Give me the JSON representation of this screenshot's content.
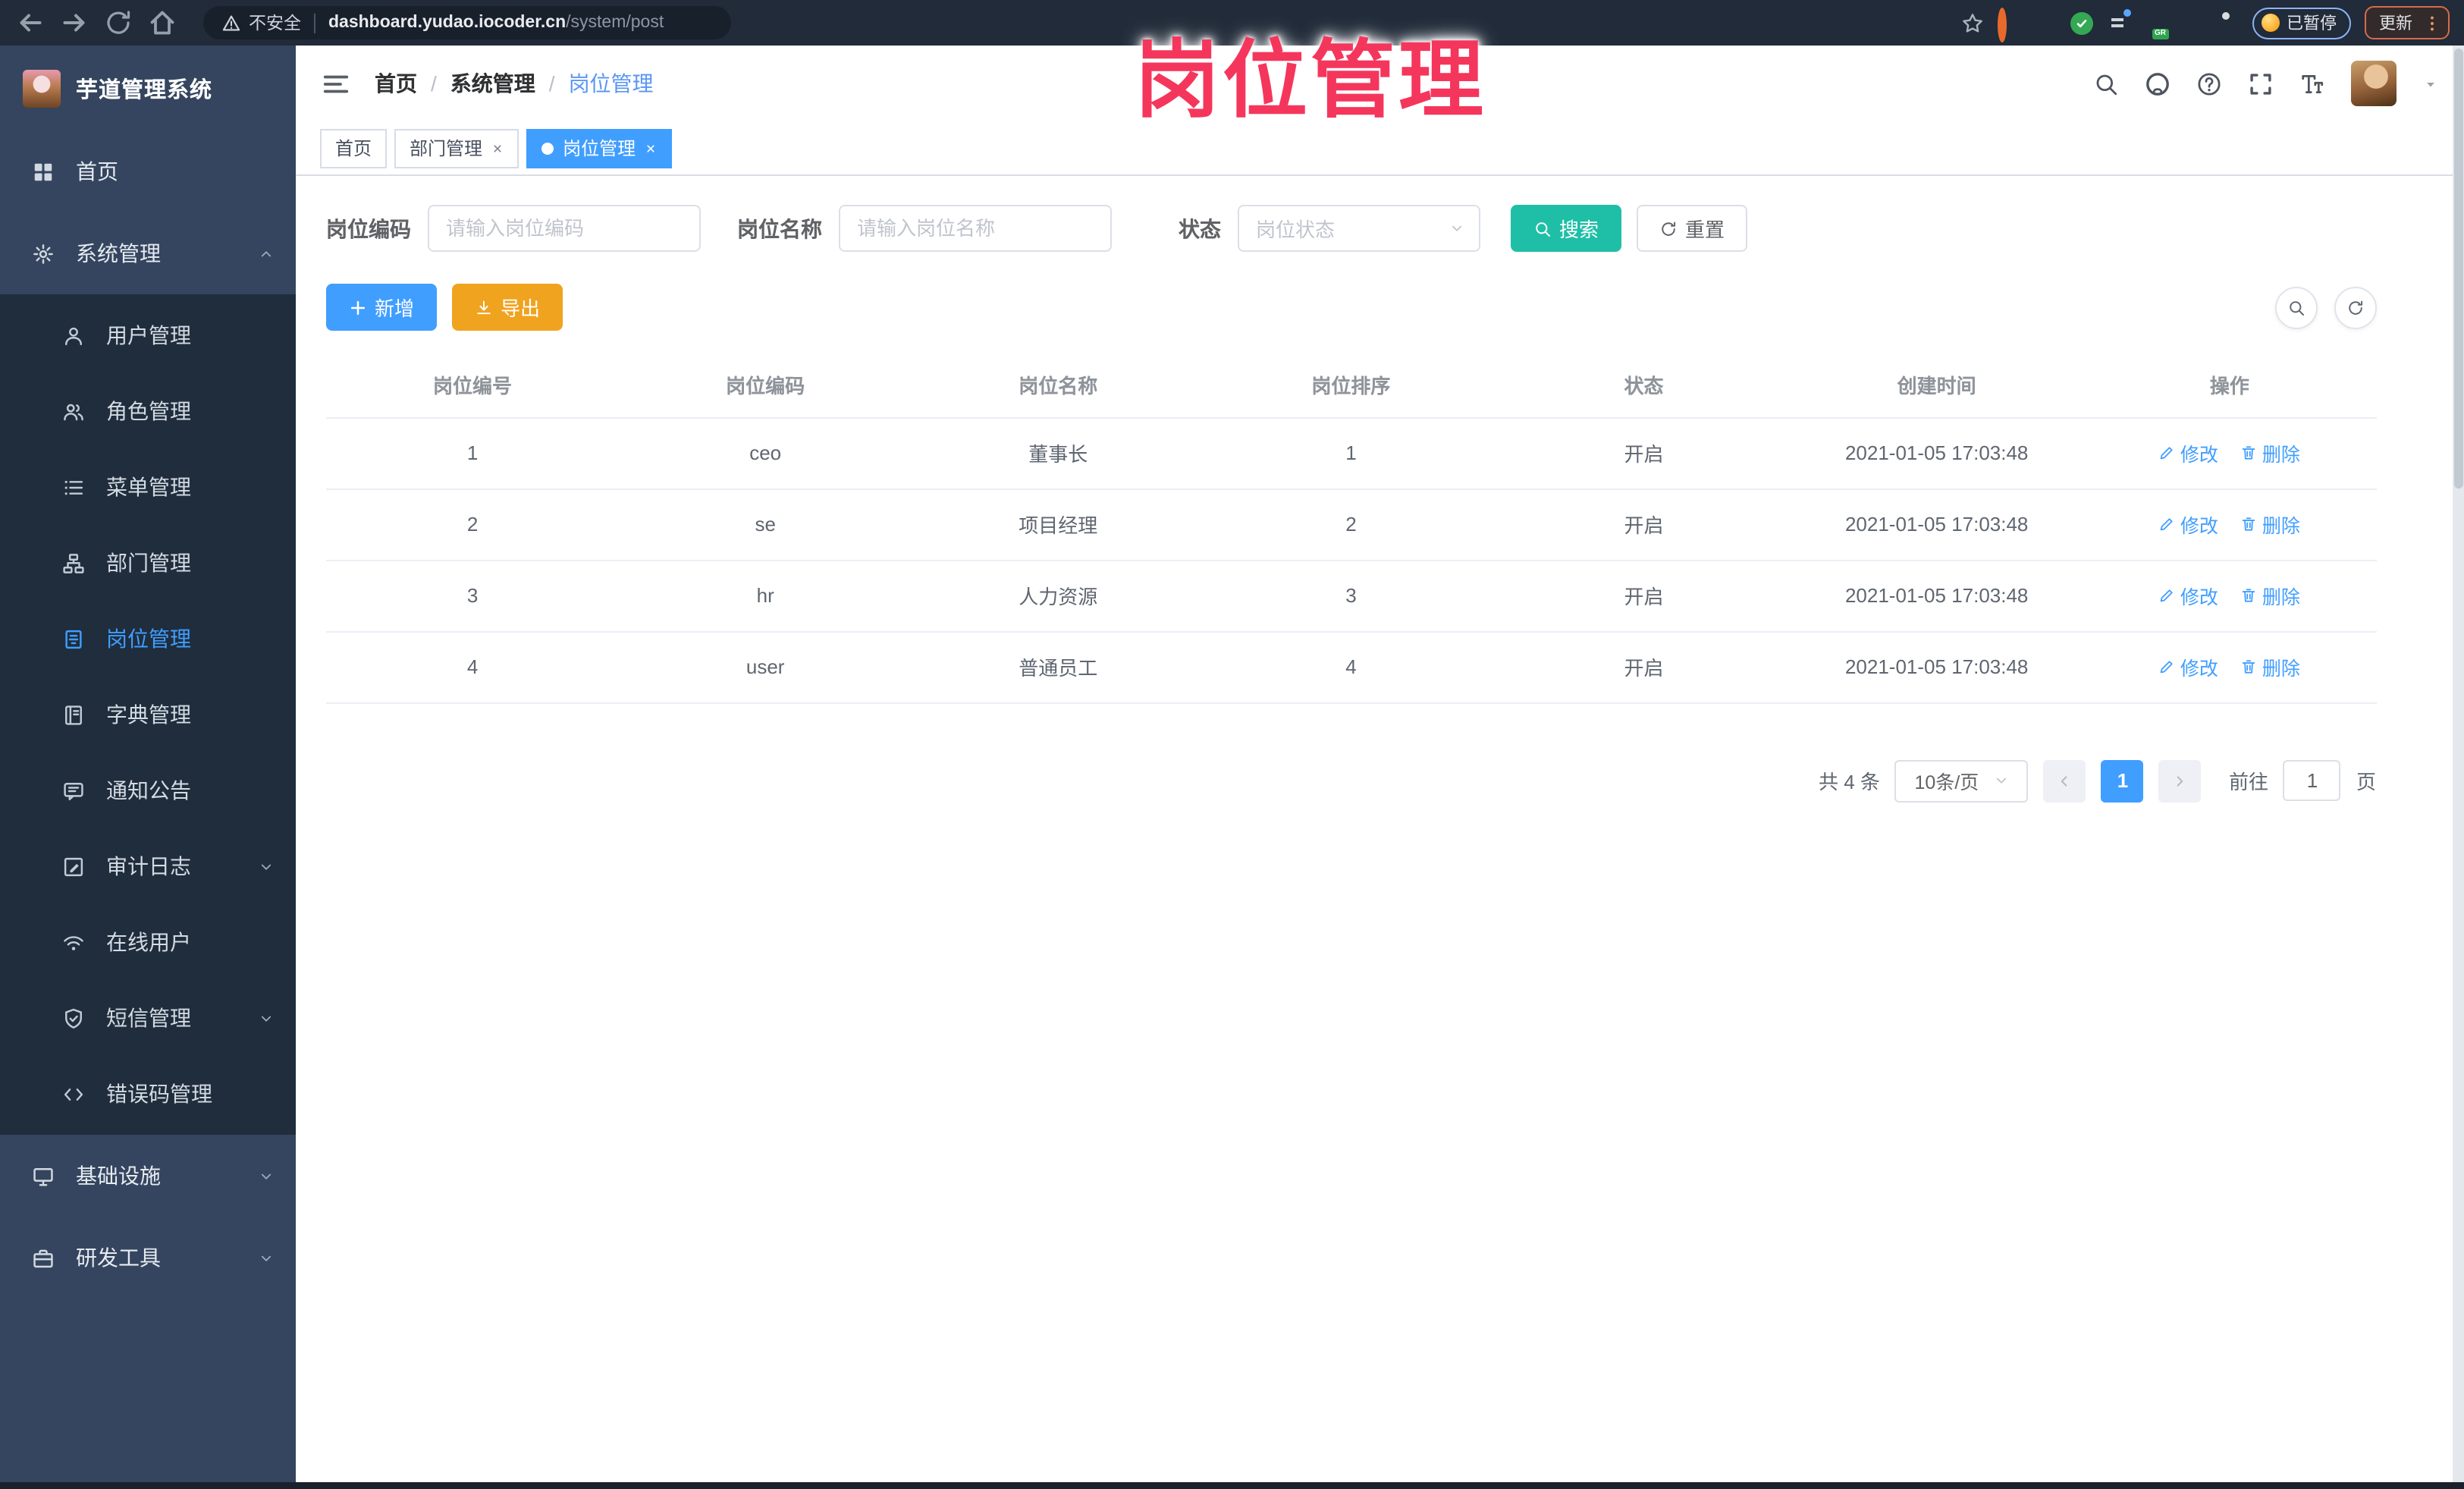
{
  "overlay_title": "岗位管理",
  "accent_colors": {
    "primary": "#409EFF",
    "success": "#1fbfa7",
    "warning": "#f0a31f",
    "annotation": "#f5365c"
  },
  "browser": {
    "security_label": "不安全",
    "url_host": "dashboard.yudao.iocoder.cn",
    "url_path": "/system/post",
    "paused_label": "已暂停",
    "update_label": "更新"
  },
  "sidebar": {
    "title": "芋道管理系统",
    "groups": [
      {
        "type": "item",
        "name": "home",
        "icon": "dashboard",
        "label": "首页"
      },
      {
        "type": "item",
        "name": "system-management",
        "icon": "gear",
        "label": "系统管理",
        "chevron": "up"
      },
      {
        "type": "submenu",
        "items": [
          {
            "name": "user-management",
            "icon": "user",
            "label": "用户管理"
          },
          {
            "name": "role-management",
            "icon": "users",
            "label": "角色管理"
          },
          {
            "name": "menu-management",
            "icon": "list",
            "label": "菜单管理"
          },
          {
            "name": "dept-management",
            "icon": "tree",
            "label": "部门管理"
          },
          {
            "name": "post-management",
            "icon": "post",
            "label": "岗位管理",
            "active": true
          },
          {
            "name": "dict-management",
            "icon": "book",
            "label": "字典管理"
          },
          {
            "name": "notice-announcement",
            "icon": "chat",
            "label": "通知公告"
          },
          {
            "name": "audit-log",
            "icon": "edit",
            "label": "审计日志",
            "chevron": "down"
          },
          {
            "name": "online-users",
            "icon": "wifi",
            "label": "在线用户"
          },
          {
            "name": "sms-management",
            "icon": "shield",
            "label": "短信管理",
            "chevron": "down"
          },
          {
            "name": "error-code-management",
            "icon": "code",
            "label": "错误码管理"
          }
        ]
      },
      {
        "type": "item",
        "name": "infrastructure",
        "icon": "infra",
        "label": "基础设施",
        "chevron": "down"
      },
      {
        "type": "item",
        "name": "dev-tools",
        "icon": "tools",
        "label": "研发工具",
        "chevron": "down"
      }
    ]
  },
  "header": {
    "breadcrumb": [
      "首页",
      "系统管理",
      "岗位管理"
    ]
  },
  "tabs": [
    {
      "name": "home",
      "label": "首页"
    },
    {
      "name": "dept-management",
      "label": "部门管理",
      "closable": true
    },
    {
      "name": "post-management",
      "label": "岗位管理",
      "closable": true,
      "active": true
    }
  ],
  "filters": {
    "code_label": "岗位编码",
    "code_placeholder": "请输入岗位编码",
    "name_label": "岗位名称",
    "name_placeholder": "请输入岗位名称",
    "status_label": "状态",
    "status_placeholder": "岗位状态",
    "search_label": "搜索",
    "reset_label": "重置"
  },
  "toolbar": {
    "add_label": "新增",
    "export_label": "导出"
  },
  "table": {
    "headers": [
      "岗位编号",
      "岗位编码",
      "岗位名称",
      "岗位排序",
      "状态",
      "创建时间",
      "操作"
    ],
    "rows": [
      {
        "id": "1",
        "code": "ceo",
        "name": "董事长",
        "sort": "1",
        "status": "开启",
        "created": "2021-01-05 17:03:48"
      },
      {
        "id": "2",
        "code": "se",
        "name": "项目经理",
        "sort": "2",
        "status": "开启",
        "created": "2021-01-05 17:03:48"
      },
      {
        "id": "3",
        "code": "hr",
        "name": "人力资源",
        "sort": "3",
        "status": "开启",
        "created": "2021-01-05 17:03:48"
      },
      {
        "id": "4",
        "code": "user",
        "name": "普通员工",
        "sort": "4",
        "status": "开启",
        "created": "2021-01-05 17:03:48"
      }
    ],
    "actions": {
      "edit": "修改",
      "delete": "删除"
    }
  },
  "pagination": {
    "total": "共 4 条",
    "page_size": "10条/页",
    "current_page": "1",
    "goto_label": "前往",
    "goto_value": "1",
    "page_unit": "页"
  }
}
